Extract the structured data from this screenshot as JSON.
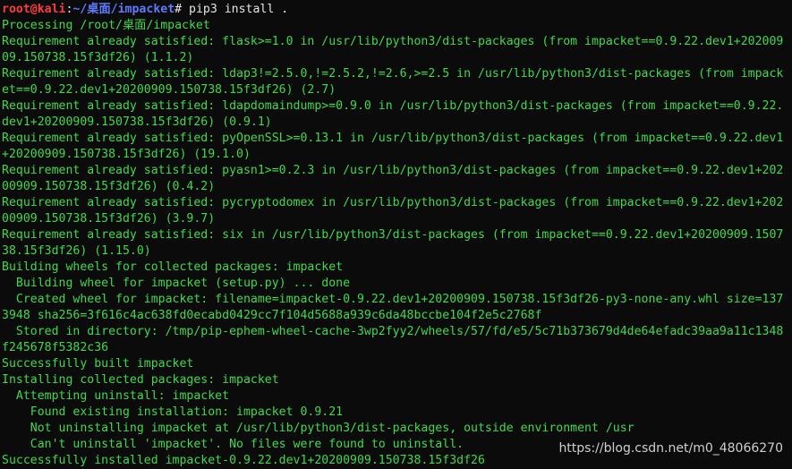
{
  "prompt": {
    "user_host": "root@kali",
    "separator": ":",
    "path": "~/桌面/impacket",
    "symbol": "#",
    "command": " pip3 install ."
  },
  "lines": [
    "Processing /root/桌面/impacket",
    "Requirement already satisfied: flask>=1.0 in /usr/lib/python3/dist-packages (from impacket==0.9.22.dev1+202009",
    "09.150738.15f3df26) (1.1.2)",
    "Requirement already satisfied: ldap3!=2.5.0,!=2.5.2,!=2.6,>=2.5 in /usr/lib/python3/dist-packages (from impack",
    "et==0.9.22.dev1+20200909.150738.15f3df26) (2.7)",
    "Requirement already satisfied: ldapdomaindump>=0.9.0 in /usr/lib/python3/dist-packages (from impacket==0.9.22.",
    "dev1+20200909.150738.15f3df26) (0.9.1)",
    "Requirement already satisfied: pyOpenSSL>=0.13.1 in /usr/lib/python3/dist-packages (from impacket==0.9.22.dev1",
    "+20200909.150738.15f3df26) (19.1.0)",
    "Requirement already satisfied: pyasn1>=0.2.3 in /usr/lib/python3/dist-packages (from impacket==0.9.22.dev1+202",
    "00909.150738.15f3df26) (0.4.2)",
    "Requirement already satisfied: pycryptodomex in /usr/lib/python3/dist-packages (from impacket==0.9.22.dev1+202",
    "00909.150738.15f3df26) (3.9.7)",
    "Requirement already satisfied: six in /usr/lib/python3/dist-packages (from impacket==0.9.22.dev1+20200909.1507",
    "38.15f3df26) (1.15.0)",
    "Building wheels for collected packages: impacket",
    "  Building wheel for impacket (setup.py) ... done",
    "  Created wheel for impacket: filename=impacket-0.9.22.dev1+20200909.150738.15f3df26-py3-none-any.whl size=137",
    "3948 sha256=3f616c4ac638fd0ecabd0429cc7f104d5688a939c6da48bccbe104f2e5c2768f",
    "  Stored in directory: /tmp/pip-ephem-wheel-cache-3wp2fyy2/wheels/57/fd/e5/5c71b373679d4de64efadc39aa9a11c1348",
    "f245678f5382c36",
    "Successfully built impacket",
    "Installing collected packages: impacket",
    "  Attempting uninstall: impacket",
    "    Found existing installation: impacket 0.9.21",
    "    Not uninstalling impacket at /usr/lib/python3/dist-packages, outside environment /usr",
    "    Can't uninstall 'impacket'. No files were found to uninstall.",
    "Successfully installed impacket-0.9.22.dev1+20200909.150738.15f3df26"
  ],
  "watermark": "https://blog.csdn.net/m0_48066270",
  "colors": {
    "background": "#0b0b0b",
    "output_text": "#3fd94a",
    "prompt_user": "#ff3b3b",
    "prompt_path": "#5b7bff"
  }
}
